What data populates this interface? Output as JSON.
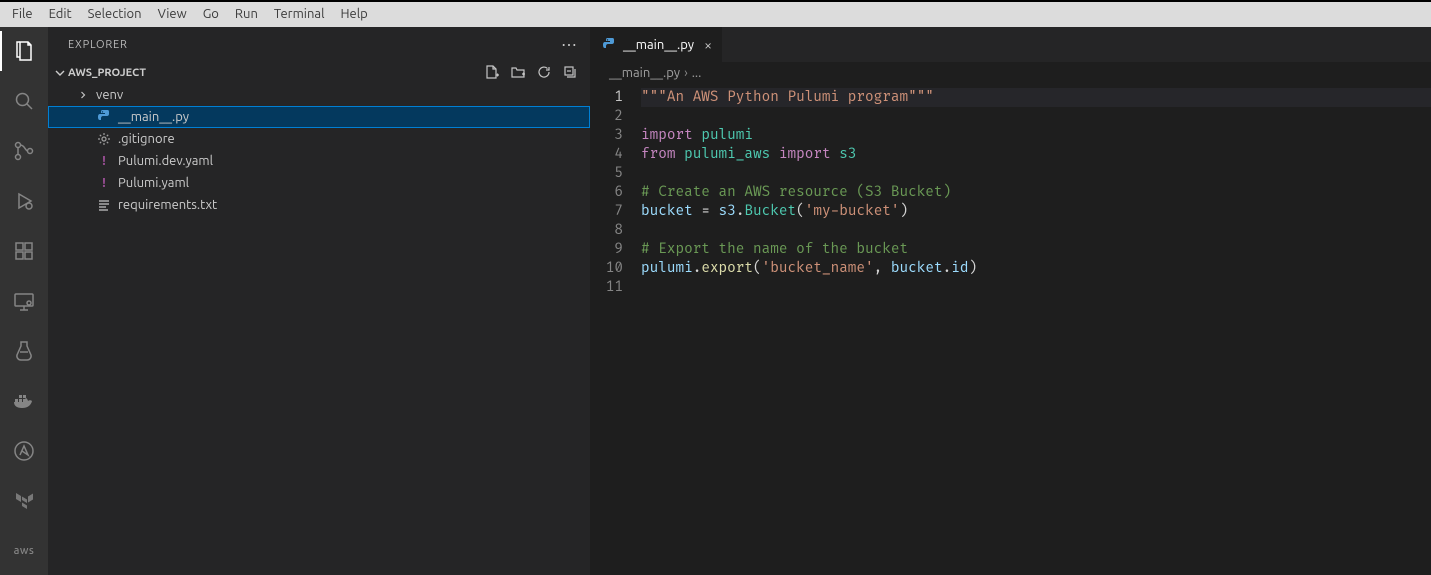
{
  "menubar": [
    "File",
    "Edit",
    "Selection",
    "View",
    "Go",
    "Run",
    "Terminal",
    "Help"
  ],
  "activitybar": {
    "items": [
      {
        "name": "explorer-icon",
        "active": true
      },
      {
        "name": "search-icon"
      },
      {
        "name": "scm-icon"
      },
      {
        "name": "run-debug-icon"
      },
      {
        "name": "extensions-icon"
      },
      {
        "name": "remote-explorer-icon"
      },
      {
        "name": "testing-icon"
      },
      {
        "name": "docker-icon"
      },
      {
        "name": "ansible-icon"
      },
      {
        "name": "terraform-icon"
      },
      {
        "name": "aws-icon",
        "label": "aws"
      }
    ]
  },
  "sidebar": {
    "title": "EXPLORER",
    "section_title": "AWS_PROJECT",
    "items": [
      {
        "name": "venv",
        "label": "venv",
        "kind": "folder"
      },
      {
        "name": "main-py",
        "label": "__main__.py",
        "kind": "python",
        "selected": true
      },
      {
        "name": "gitignore",
        "label": ".gitignore",
        "kind": "gear"
      },
      {
        "name": "pulumi-dev-yaml",
        "label": "Pulumi.dev.yaml",
        "kind": "yaml"
      },
      {
        "name": "pulumi-yaml",
        "label": "Pulumi.yaml",
        "kind": "yaml"
      },
      {
        "name": "requirements-txt",
        "label": "requirements.txt",
        "kind": "lines"
      }
    ]
  },
  "tabs": {
    "open": [
      {
        "label": "__main__.py",
        "icon": "python"
      }
    ]
  },
  "breadcrumbs": {
    "file": "__main__.py",
    "trail": "..."
  },
  "editor": {
    "line_count": 11,
    "current_line": 1,
    "lines": [
      [
        {
          "t": "str",
          "v": "\"\"\"An AWS Python Pulumi program\"\"\""
        }
      ],
      [],
      [
        {
          "t": "kw",
          "v": "import"
        },
        {
          "t": "sp",
          "v": " "
        },
        {
          "t": "mod",
          "v": "pulumi"
        }
      ],
      [
        {
          "t": "kw",
          "v": "from"
        },
        {
          "t": "sp",
          "v": " "
        },
        {
          "t": "mod",
          "v": "pulumi_aws"
        },
        {
          "t": "sp",
          "v": " "
        },
        {
          "t": "kw",
          "v": "import"
        },
        {
          "t": "sp",
          "v": " "
        },
        {
          "t": "mod",
          "v": "s3"
        }
      ],
      [],
      [
        {
          "t": "cmt",
          "v": "# Create an AWS resource (S3 Bucket)"
        }
      ],
      [
        {
          "t": "var",
          "v": "bucket"
        },
        {
          "t": "sp",
          "v": " "
        },
        {
          "t": "op",
          "v": "="
        },
        {
          "t": "sp",
          "v": " "
        },
        {
          "t": "var",
          "v": "s3"
        },
        {
          "t": "punc",
          "v": "."
        },
        {
          "t": "cls",
          "v": "Bucket"
        },
        {
          "t": "punc",
          "v": "("
        },
        {
          "t": "str",
          "v": "'my-bucket'"
        },
        {
          "t": "punc",
          "v": ")"
        }
      ],
      [],
      [
        {
          "t": "cmt",
          "v": "# Export the name of the bucket"
        }
      ],
      [
        {
          "t": "var",
          "v": "pulumi"
        },
        {
          "t": "punc",
          "v": "."
        },
        {
          "t": "fn",
          "v": "export"
        },
        {
          "t": "punc",
          "v": "("
        },
        {
          "t": "str",
          "v": "'bucket_name'"
        },
        {
          "t": "punc",
          "v": ","
        },
        {
          "t": "sp",
          "v": " "
        },
        {
          "t": "var",
          "v": "bucket"
        },
        {
          "t": "punc",
          "v": "."
        },
        {
          "t": "var",
          "v": "id"
        },
        {
          "t": "punc",
          "v": ")"
        }
      ],
      []
    ]
  }
}
